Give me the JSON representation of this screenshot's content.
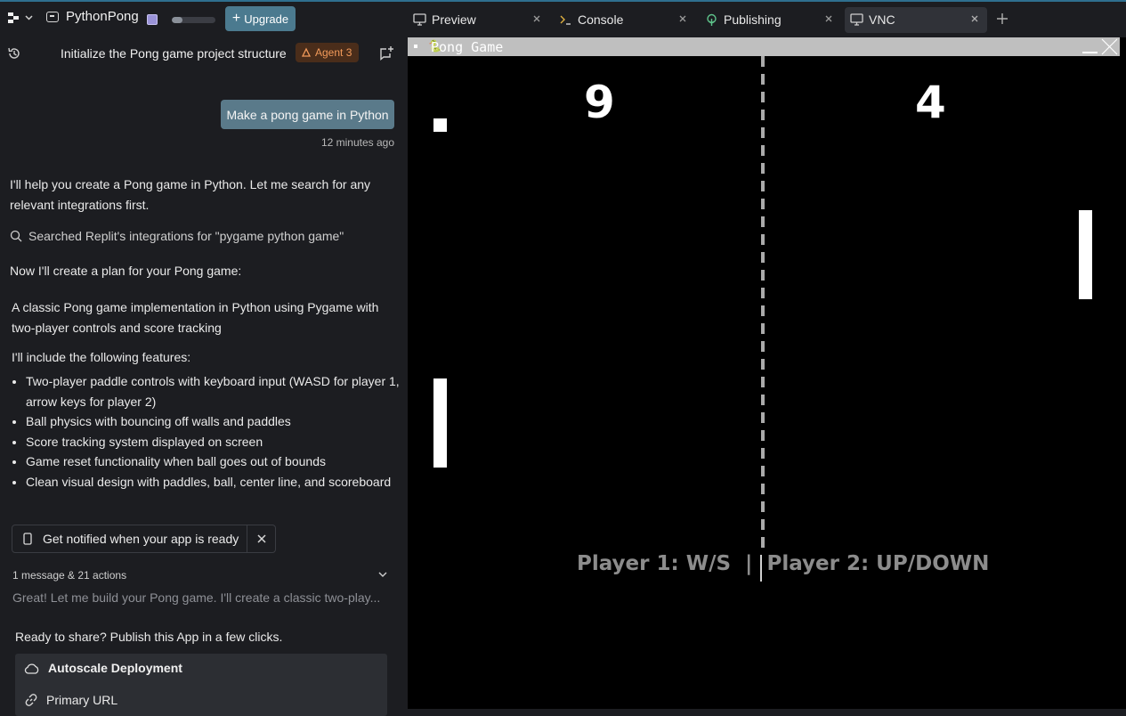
{
  "app": {
    "project_name": "PythonPong",
    "upgrade_label": "Upgrade",
    "usage_fraction": 0.25
  },
  "chat": {
    "title": "Initialize the Pong game project structure",
    "agent_badge": "Agent 3",
    "user_message": "Make a pong game in Python",
    "user_message_time": "12 minutes ago",
    "intro": "I'll help you create a Pong game in Python. Let me search for any relevant integrations first.",
    "search_text": "Searched Replit's integrations for \"pygame python game\"",
    "plan_intro": "Now I'll create a plan for your Pong game:",
    "plan_summary": "A classic Pong game implementation in Python using Pygame with two-player controls and score tracking",
    "features_intro": "I'll include the following features:",
    "features": [
      "Two-player paddle controls with keyboard input (WASD for player 1, arrow keys for player 2)",
      "Ball physics with bouncing off walls and paddles",
      "Score tracking system displayed on screen",
      "Game reset functionality when ball goes out of bounds",
      "Clean visual design with paddles, ball, center line, and scoreboard"
    ],
    "notify_label": "Get notified when your app is ready",
    "actions_summary": "1 message & 21 actions",
    "action_preview": "Great! Let me build your Pong game. I'll create a classic two-play...",
    "share_text": "Ready to share? Publish this App in a few clicks.",
    "deploy_title": "Autoscale Deployment",
    "deploy_url_label": "Primary URL"
  },
  "tabs": [
    {
      "label": "Preview",
      "icon": "monitor-icon"
    },
    {
      "label": "Console",
      "icon": "terminal-icon"
    },
    {
      "label": "Publishing",
      "icon": "publish-icon"
    },
    {
      "label": "VNC",
      "icon": "monitor-icon",
      "active": true
    }
  ],
  "vnc": {
    "window_title": "Pong Game",
    "score_left": "9",
    "score_right": "4",
    "controls_text": "Player 1: W/S  |  Player 2: UP/DOWN",
    "colors": {
      "background": "#000000",
      "foreground": "#ffffff",
      "controls_text": "#8c8c8c"
    }
  },
  "colors": {
    "panel_bg": "#1c1d21",
    "user_bubble": "#5a7a8a",
    "upgrade_button": "#4b7a8f",
    "agent_badge_bg": "#4a2d1a",
    "agent_badge_fg": "#f29a5a"
  }
}
